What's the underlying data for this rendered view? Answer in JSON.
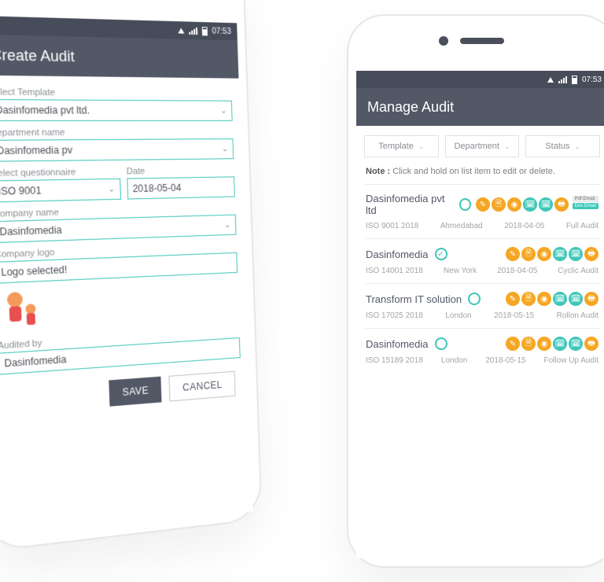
{
  "status": {
    "time": "07:53"
  },
  "left": {
    "title": "Create Audit",
    "labels": {
      "template": "Select Template",
      "department": "Department name",
      "questionnaire": "Select questionnaire",
      "date": "Date",
      "company": "Company name",
      "logo": "Company logo",
      "audited_by": "Audited by"
    },
    "values": {
      "template": "Dasinfomedia pvt ltd.",
      "department": "Dasinfomedia pv",
      "questionnaire": "ISO 9001",
      "date": "2018-05-04",
      "company": "Dasinfomedia",
      "logo": "Logo selected!",
      "audited_by": "Dasinfomedia"
    },
    "buttons": {
      "save": "SAVE",
      "cancel": "CANCEL"
    }
  },
  "right": {
    "title": "Manage Audit",
    "filters": {
      "template": "Template",
      "department": "Department",
      "status": "Status"
    },
    "note_label": "Note :",
    "note_text": "Click and hold on list item to edit or delete.",
    "action_tags": {
      "pdf": "Pdf:Email",
      "doc": "Doc:Email"
    },
    "items": [
      {
        "title": "Dasinfomedia pvt ltd",
        "checked": false,
        "iso": "ISO 9001 2018",
        "city": "Ahmedabad",
        "date": "2018-04-05",
        "type": "Full Audit",
        "show_tags": true
      },
      {
        "title": "Dasinfomedia",
        "checked": true,
        "iso": "ISO 14001 2018",
        "city": "New York",
        "date": "2018-04-05",
        "type": "Cyclic Audit",
        "show_tags": false
      },
      {
        "title": "Transform IT solution",
        "checked": false,
        "iso": "ISO 17025 2018",
        "city": "London",
        "date": "2018-05-15",
        "type": "Rollon Audit",
        "show_tags": false
      },
      {
        "title": "Dasinfomedia",
        "checked": false,
        "iso": "ISO 15189 2018",
        "city": "London",
        "date": "2018-05-15",
        "type": "Follow Up Audit",
        "show_tags": false
      }
    ]
  }
}
